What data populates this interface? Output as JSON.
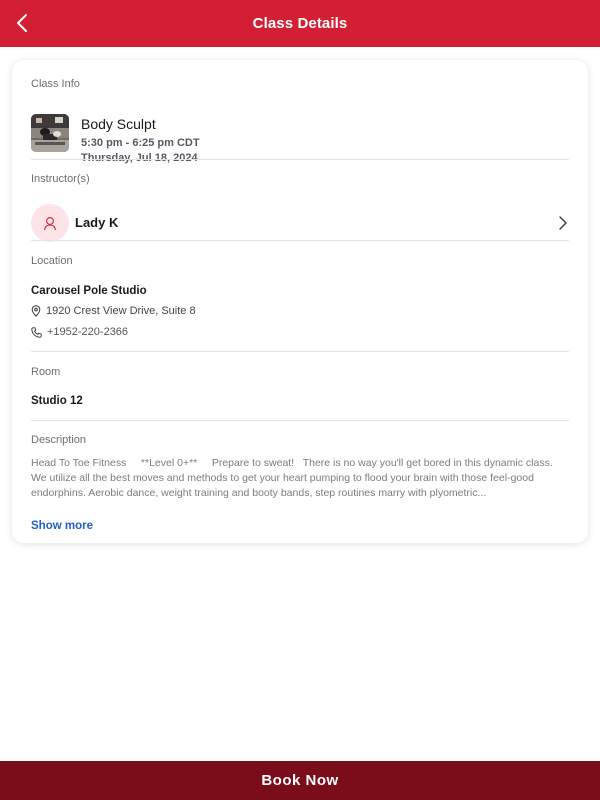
{
  "header": {
    "title": "Class Details"
  },
  "class_info": {
    "label": "Class Info",
    "name": "Body Sculpt",
    "time": "5:30 pm - 6:25 pm CDT",
    "date": "Thursday, Jul 18, 2024"
  },
  "instructors": {
    "label": "Instructor(s)",
    "name": "Lady K"
  },
  "location": {
    "label": "Location",
    "name": "Carousel Pole Studio",
    "address": "1920 Crest View Drive, Suite 8",
    "phone": "+1952-220-2366"
  },
  "room": {
    "label": "Room",
    "name": "Studio 12"
  },
  "description": {
    "label": "Description",
    "text": "Head To Toe Fitness     **Level 0+**     Prepare to sweat!   There is no way you'll get bored in this dynamic class. We utilize all the best moves and methods to get your heart pumping to flood your brain with those feel-good endorphins. Aerobic dance, weight training and booty bands, step routines marry with plyometric...",
    "show_more": "Show more"
  },
  "footer": {
    "book_label": "Book Now"
  },
  "colors": {
    "header_bg": "#d31f34",
    "footer_bg": "#7b0d1a",
    "link": "#2160c4",
    "avatar_bg": "#fbe3e7"
  },
  "icons": {
    "back": "chevron-left-icon",
    "instructor_avatar": "person-icon",
    "instructor_chevron": "chevron-right-icon",
    "address": "map-pin-icon",
    "phone": "phone-icon"
  }
}
